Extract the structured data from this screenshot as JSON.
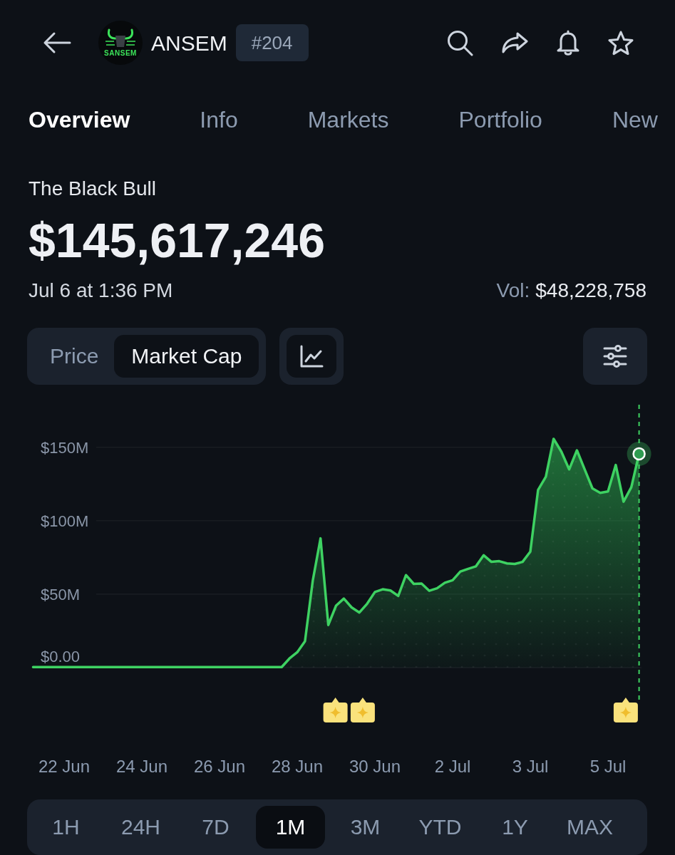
{
  "header": {
    "logo_text": "SANSEM",
    "symbol": "ANSEM",
    "rank": "#204"
  },
  "tabs": [
    {
      "label": "Overview",
      "selected": true
    },
    {
      "label": "Info",
      "selected": false
    },
    {
      "label": "Markets",
      "selected": false
    },
    {
      "label": "Portfolio",
      "selected": false
    },
    {
      "label": "New",
      "selected": false
    }
  ],
  "coin_name": "The Black Bull",
  "value": "$145,617,246",
  "timestamp": "Jul 6 at 1:36 PM",
  "volume": {
    "label": "Vol:",
    "value": "$48,228,758"
  },
  "metric_toggle": [
    {
      "label": "Price",
      "selected": false
    },
    {
      "label": "Market Cap",
      "selected": true
    }
  ],
  "chart": {
    "chart_data": {
      "type": "area",
      "grid": true,
      "categories": [
        null,
        null,
        null,
        null,
        "22 Jun",
        null,
        null,
        null,
        null,
        null,
        null,
        null,
        null,
        null,
        "24 Jun",
        null,
        null,
        null,
        null,
        null,
        null,
        null,
        null,
        null,
        "26 Jun",
        null,
        null,
        null,
        null,
        null,
        null,
        null,
        null,
        null,
        "28 Jun",
        null,
        null,
        null,
        null,
        null,
        null,
        null,
        null,
        null,
        "30 Jun",
        null,
        null,
        null,
        null,
        null,
        null,
        null,
        null,
        null,
        "2 Jul",
        null,
        null,
        null,
        null,
        null,
        null,
        null,
        null,
        null,
        "3 Jul",
        null,
        null,
        null,
        null,
        null,
        null,
        null,
        null,
        null,
        "5 Jul",
        null,
        null,
        null,
        null
      ],
      "series": [
        {
          "color": "#3ed262",
          "values": [
            0.4,
            0.4,
            0.4,
            0.4,
            0.4,
            0.4,
            0.4,
            0.4,
            0.4,
            0.4,
            0.4,
            0.4,
            0.4,
            0.4,
            0.4,
            0.4,
            0.4,
            0.4,
            0.4,
            0.4,
            0.4,
            0.4,
            0.4,
            0.4,
            0.4,
            0.4,
            0.4,
            0.4,
            0.4,
            0.4,
            0.4,
            0.4,
            0.4,
            6.2,
            10.5,
            18.0,
            59.2,
            88.0,
            29.0,
            42.2,
            47.0,
            41.0,
            37.5,
            43.5,
            51.5,
            53.3,
            52.5,
            48.8,
            63.0,
            57.0,
            57.3,
            52.3,
            54.0,
            57.8,
            59.5,
            65.4,
            67.3,
            69.0,
            76.5,
            72.0,
            72.5,
            71.0,
            70.6,
            72.0,
            79.0,
            121.0,
            130.0,
            155.8,
            147.0,
            135.0,
            148.0,
            135.0,
            122.0,
            119.0,
            120.0,
            138.0,
            113.0,
            122.8,
            145.6
          ]
        }
      ],
      "ylim": [
        0,
        180
      ],
      "yticks": [
        {
          "value": 0,
          "label": "$0.00"
        },
        {
          "value": 50,
          "label": "$50M"
        },
        {
          "value": 100,
          "label": "$100M"
        },
        {
          "value": 150,
          "label": "$150M"
        }
      ]
    },
    "event_markers": [
      {
        "kind": "event"
      },
      {
        "kind": "event"
      },
      {
        "kind": "event"
      }
    ]
  },
  "ranges": [
    {
      "label": "1H",
      "selected": false
    },
    {
      "label": "24H",
      "selected": false
    },
    {
      "label": "7D",
      "selected": false
    },
    {
      "label": "1M",
      "selected": true
    },
    {
      "label": "3M",
      "selected": false
    },
    {
      "label": "YTD",
      "selected": false
    },
    {
      "label": "1Y",
      "selected": false
    },
    {
      "label": "MAX",
      "selected": false
    }
  ]
}
